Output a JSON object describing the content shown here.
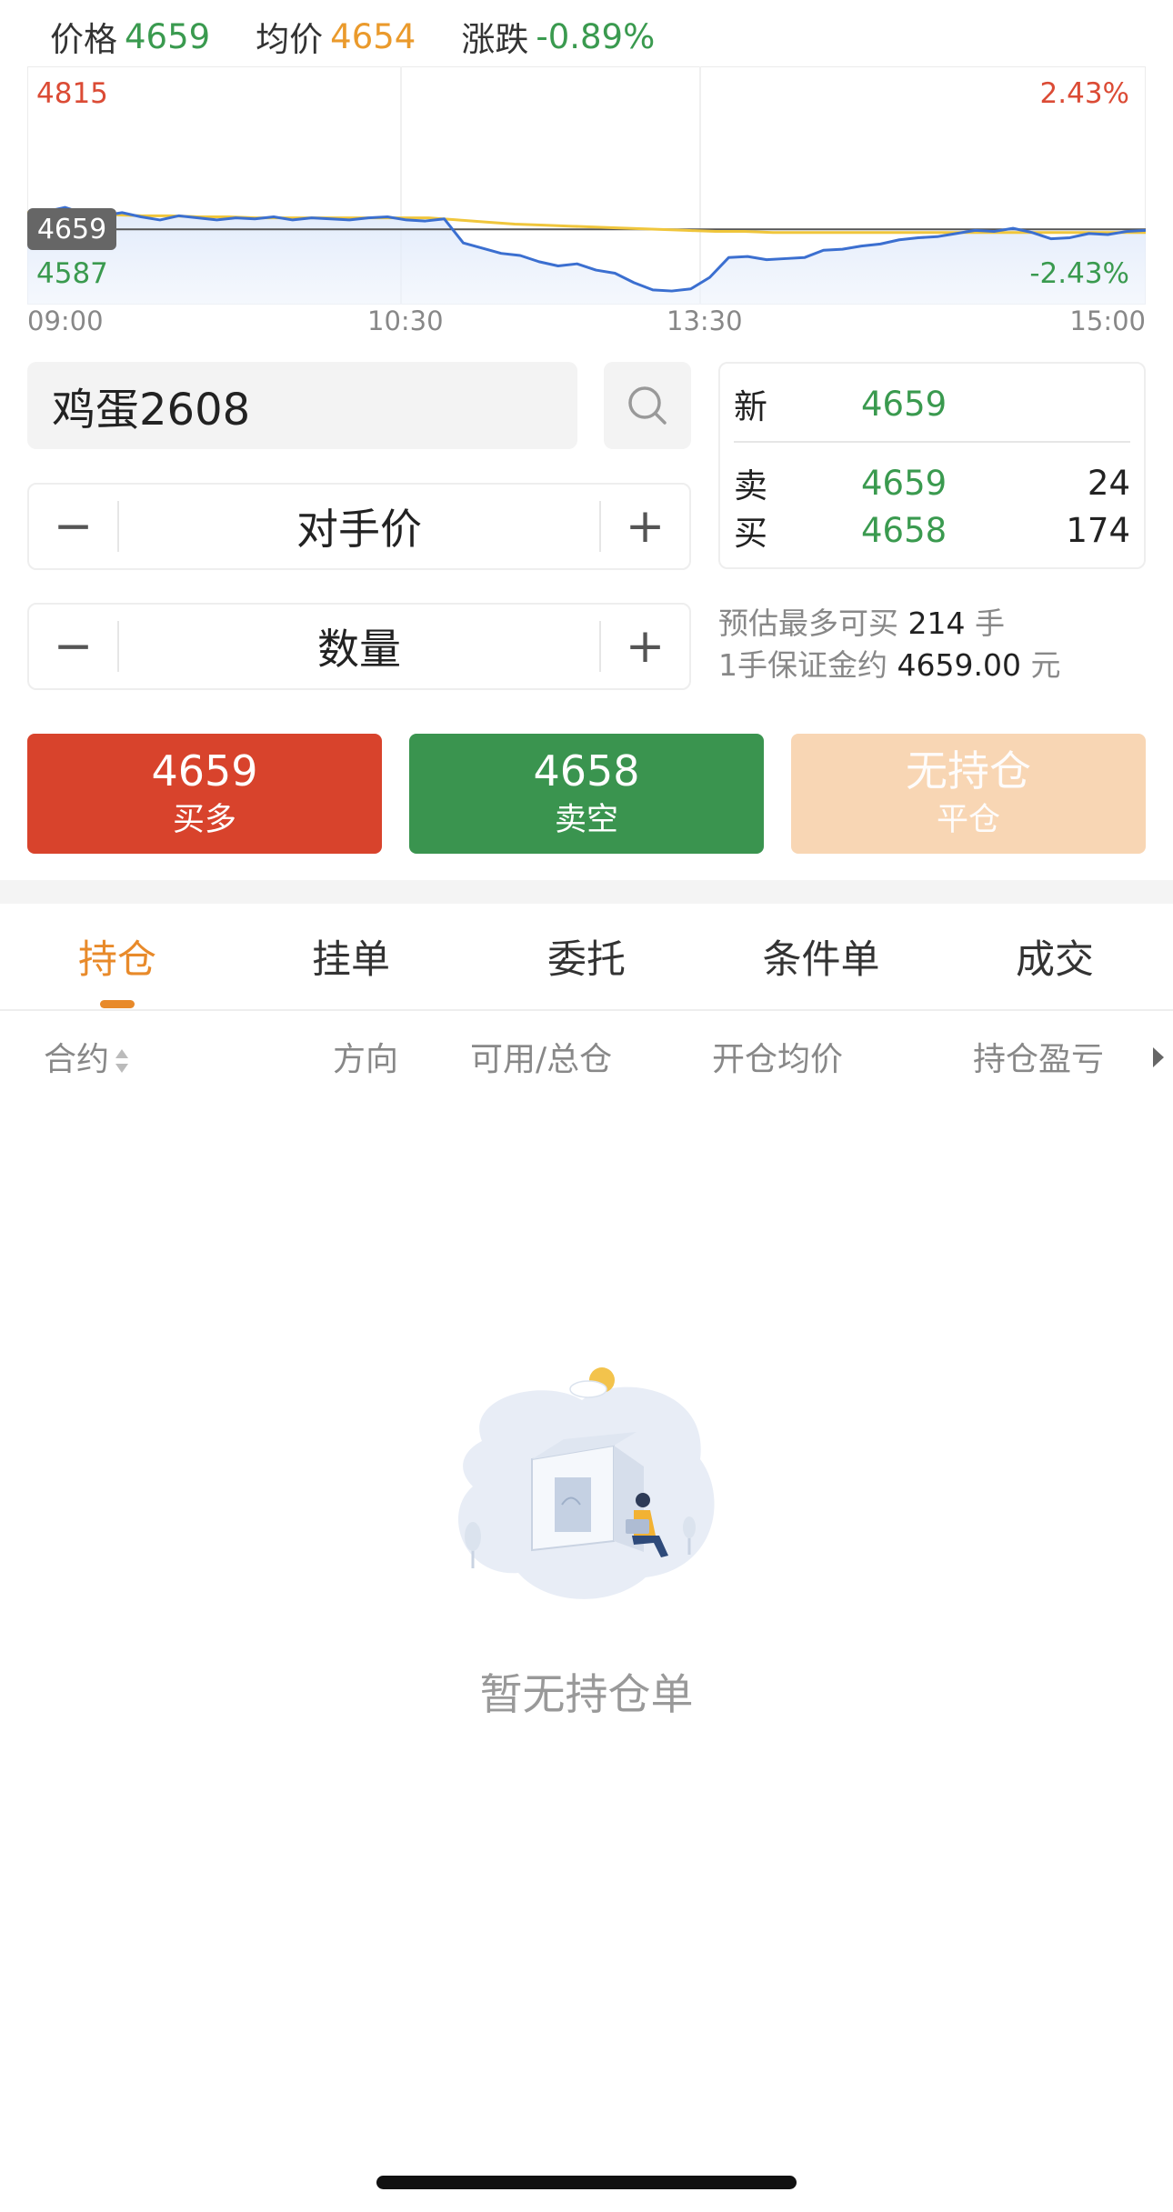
{
  "ticker": {
    "price_label": "价格",
    "price": "4659",
    "avg_label": "均价",
    "avg": "4654",
    "change_label": "涨跌",
    "change": "-0.89%"
  },
  "chart": {
    "high": "4815",
    "low": "4587",
    "current": "4659",
    "pct_high": "2.43%",
    "pct_low": "-2.43%",
    "times": [
      "09:00",
      "10:30",
      "13:30",
      "15:00"
    ],
    "colors": {
      "price_line": "#3b6fd0",
      "avg_line": "#f0c63c",
      "ref_line": "#555555"
    }
  },
  "chart_data": {
    "type": "line",
    "x": [
      "09:00",
      "10:30",
      "13:30",
      "15:00"
    ],
    "ylim": [
      4587,
      4815
    ],
    "reference": 4659,
    "series": [
      {
        "values": [
          4671,
          4676,
          4680,
          4674,
          4672,
          4675,
          4671,
          4668,
          4672,
          4670,
          4668,
          4670,
          4669,
          4671,
          4668,
          4670,
          4669,
          4668,
          4670,
          4671,
          4668,
          4667,
          4669,
          4646,
          4641,
          4636,
          4634,
          4628,
          4624,
          4626,
          4620,
          4617,
          4608,
          4601,
          4600,
          4602,
          4613,
          4632,
          4633,
          4630,
          4631,
          4632,
          4639,
          4640,
          4643,
          4645,
          4649,
          4651,
          4652,
          4655,
          4658,
          4657,
          4660,
          4656,
          4650,
          4651,
          4655,
          4654,
          4657,
          4658
        ]
      },
      {
        "values": [
          4675,
          4674,
          4673,
          4673,
          4672,
          4672,
          4671,
          4671,
          4670,
          4670,
          4670,
          4670,
          4670,
          4670,
          4670,
          4668,
          4666,
          4664,
          4663,
          4662,
          4661,
          4660,
          4659,
          4658,
          4657,
          4657,
          4656,
          4656,
          4656,
          4656,
          4656,
          4656,
          4656,
          4656,
          4656,
          4656,
          4656,
          4656,
          4656,
          4656
        ]
      }
    ]
  },
  "order": {
    "symbol": "鸡蛋2608",
    "price_mode": "对手价",
    "qty_label": "数量",
    "minus": "−",
    "plus": "+"
  },
  "quote": {
    "last_label": "新",
    "last": "4659",
    "ask_label": "卖",
    "ask": "4659",
    "ask_vol": "24",
    "bid_label": "买",
    "bid": "4658",
    "bid_vol": "174"
  },
  "estimate": {
    "max_prefix": "预估最多可买",
    "max_value": "214",
    "max_unit": "手",
    "margin_prefix": "1手保证金约",
    "margin_value": "4659.00",
    "margin_unit": "元"
  },
  "actions": {
    "buy_price": "4659",
    "buy_label": "买多",
    "sell_price": "4658",
    "sell_label": "卖空",
    "close_top": "无持仓",
    "close_label": "平仓"
  },
  "tabs": [
    "持仓",
    "挂单",
    "委托",
    "条件单",
    "成交"
  ],
  "table_header": [
    "合约",
    "方向",
    "可用/总仓",
    "开仓均价",
    "持仓盈亏"
  ],
  "empty_text": "暂无持仓单"
}
